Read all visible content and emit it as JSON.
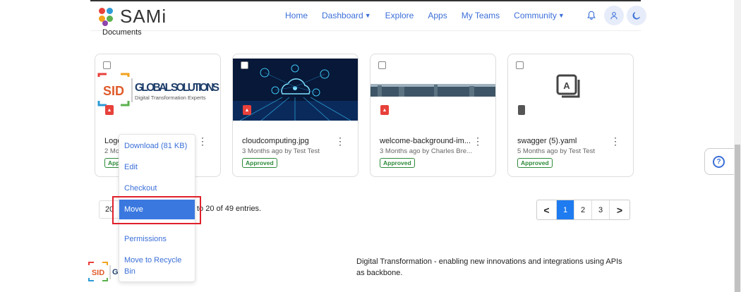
{
  "header": {
    "brand": "SAMi",
    "nav": [
      {
        "label": "Home",
        "dropdown": false
      },
      {
        "label": "Dashboard",
        "dropdown": true
      },
      {
        "label": "Explore",
        "dropdown": false
      },
      {
        "label": "Apps",
        "dropdown": false
      },
      {
        "label": "My Teams",
        "dropdown": false
      },
      {
        "label": "Community",
        "dropdown": true
      }
    ],
    "icons": [
      "bell-icon",
      "user-icon",
      "moon-icon"
    ]
  },
  "breadcrumb": "Documents",
  "files": [
    {
      "name": "Logo",
      "meta": "2 Mo",
      "status": "Approved",
      "type": "image",
      "thumb": "global-solutions-logo",
      "thumb_text": {
        "sid": "SID",
        "title": "GLOBAL SOLUTIONS",
        "subtitle": "Digital Transformation Experts"
      }
    },
    {
      "name": "cloudcomputing.jpg",
      "meta": "3 Months ago by Test Test",
      "status": "Approved",
      "type": "image",
      "thumb": "cloud-computing-photo"
    },
    {
      "name": "welcome-background-im...",
      "meta": "3 Months ago by Charles Bre...",
      "status": "Approved",
      "type": "image",
      "thumb": "city-skyline-photo"
    },
    {
      "name": "swagger (5).yaml",
      "meta": "5 Months ago by Test Test",
      "status": "Approved",
      "type": "file",
      "thumb": "document-icon"
    }
  ],
  "context_menu": {
    "items": [
      "Download (81 KB)",
      "Edit",
      "Checkout",
      "Move",
      "Permissions",
      "Move to Recycle Bin"
    ],
    "highlighted": "Move"
  },
  "pagination": {
    "page_size": "20",
    "summary": "to 20 of 49 entries.",
    "pages": [
      "1",
      "2",
      "3"
    ],
    "current": "1",
    "prev": "<",
    "next": ">"
  },
  "footer": {
    "text": "Digital Transformation - enabling new innovations and integrations using APIs as backbone.",
    "logo_text": "SID",
    "logo_fragment": "G"
  },
  "help": "?",
  "colors": {
    "accent": "#3b6fd8",
    "highlight": "#3a78e0",
    "approved": "#2e8b3a",
    "callout": "#e0202a",
    "pager_active": "#1e7bf0"
  }
}
